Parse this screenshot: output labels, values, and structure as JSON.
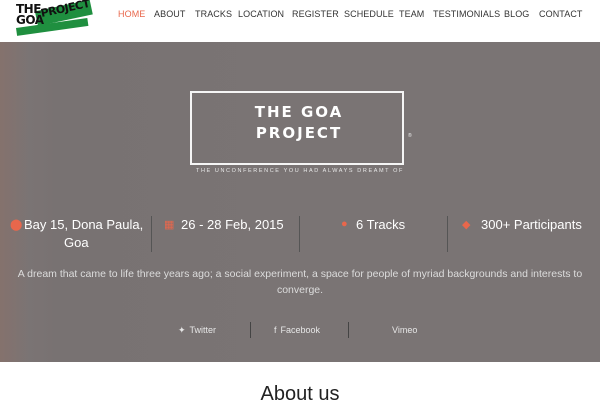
{
  "logo": {
    "line1": "THE",
    "line2": "GOA",
    "line3": "PROJECT"
  },
  "nav": [
    {
      "label": "HOME",
      "active": true
    },
    {
      "label": "ABOUT"
    },
    {
      "label": "TRACKS"
    },
    {
      "label": "LOCATION"
    },
    {
      "label": "REGISTER"
    },
    {
      "label": "SCHEDULE"
    },
    {
      "label": "TEAM"
    },
    {
      "label": "TESTIMONIALS"
    },
    {
      "label": "BLOG"
    },
    {
      "label": "CONTACT"
    }
  ],
  "hero": {
    "title_line1": "THE GOA",
    "title_line2": "PROJECT",
    "registered": "®",
    "tagline": "THE UNCONFERENCE YOU HAD ALWAYS DREAMT OF"
  },
  "info": [
    {
      "icon": "map-pin-icon",
      "glyph": "⬤",
      "line1": "Bay 15, Dona Paula,",
      "line2": "Goa"
    },
    {
      "icon": "calendar-icon",
      "glyph": "▦",
      "line1": "26 - 28 Feb, 2015"
    },
    {
      "icon": "tracks-icon",
      "glyph": "●",
      "line1": "6 Tracks"
    },
    {
      "icon": "participants-icon",
      "glyph": "◆",
      "line1": "300+ Participants"
    }
  ],
  "description": "A dream that came to life three years ago; a social experiment, a space for people of myriad backgrounds and interests to converge.",
  "social": [
    {
      "label": "Twitter",
      "icon": "twitter-icon",
      "glyph": "✦"
    },
    {
      "label": "Facebook",
      "icon": "facebook-icon",
      "glyph": "f"
    },
    {
      "label": "Vimeo",
      "icon": "vimeo-icon",
      "glyph": ""
    }
  ],
  "about_heading": "About us",
  "colors": {
    "accent": "#e8674c",
    "hero_bg": "#7a7474",
    "logo_green": "#1f8f3f"
  }
}
